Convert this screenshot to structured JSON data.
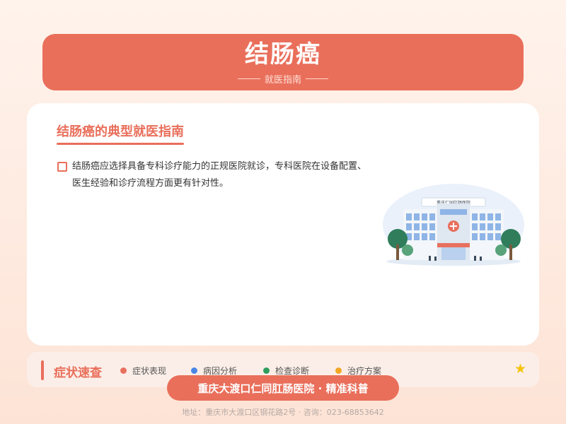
{
  "header": {
    "title": "结肠癌",
    "subtitle": "就医指南"
  },
  "card": {
    "heading": "结肠癌的典型就医指南",
    "bullets": [
      {
        "text": "结肠癌应选择具备专科诊疗能力的正规医院就诊，专科医院在设备配置、医生经验和诊疗流程方面更有针对性。"
      }
    ],
    "illustration": {
      "sign_text": "重庆仁同肛肠医院"
    }
  },
  "bar": {
    "title": "症状速查",
    "legend": [
      {
        "label": "症状表现",
        "color": "#e8705e"
      },
      {
        "label": "病因分析",
        "color": "#4a86e8"
      },
      {
        "label": "检查诊断",
        "color": "#2e9e5e"
      },
      {
        "label": "治疗方案",
        "color": "#f2a623"
      }
    ],
    "star": "★"
  },
  "footer": {
    "badge": "重庆大渡口仁同肛肠医院 · 精准科普",
    "address": "地址：重庆市大渡口区钢花路2号 · 咨询：023-68853642"
  },
  "colors": {
    "accent": "#e96f5b",
    "star": "#f6c30d"
  }
}
